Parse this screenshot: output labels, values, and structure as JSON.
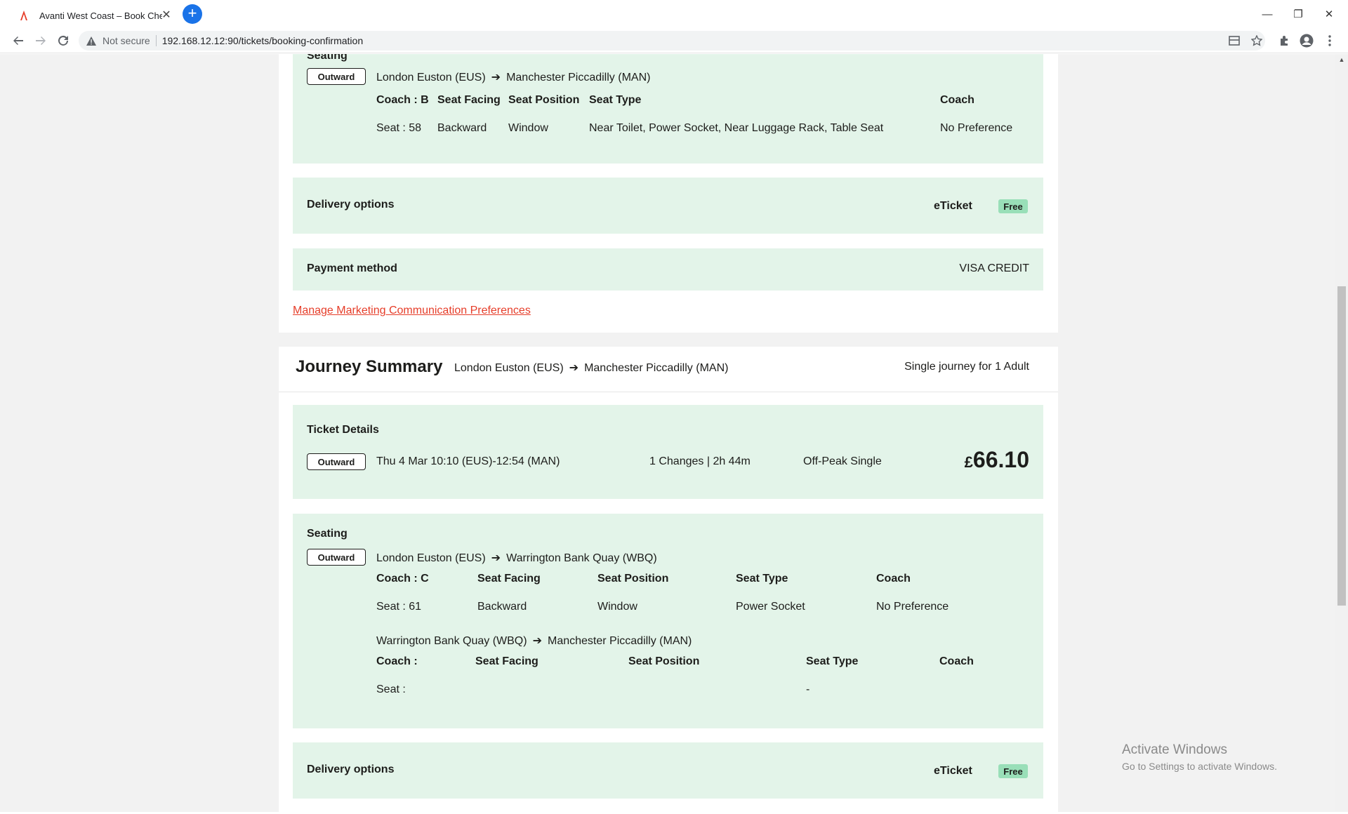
{
  "browser": {
    "tab_title": "Avanti West Coast – Book Cheap",
    "tab_close_glyph": "✕",
    "new_tab_glyph": "+",
    "security_label": "Not secure",
    "url": "192.168.12.12:90/tickets/booking-confirmation",
    "window_controls": {
      "minimize": "—",
      "restore": "❐",
      "close": "✕"
    }
  },
  "top_seating": {
    "direction_badge": "Outward",
    "route_from": "London Euston (EUS)",
    "route_to": "Manchester Piccadilly (MAN)",
    "heading": "Seating",
    "headers": {
      "coach": "Coach : B",
      "seat_facing": "Seat Facing",
      "seat_position": "Seat Position",
      "seat_type": "Seat Type",
      "coach_pref": "Coach"
    },
    "row": {
      "seat": "Seat : 58",
      "seat_facing": "Backward",
      "seat_position": "Window",
      "seat_type": "Near Toilet, Power Socket, Near Luggage Rack, Table Seat",
      "coach_pref": "No Preference"
    }
  },
  "top_delivery": {
    "label": "Delivery options",
    "method": "eTicket",
    "badge": "Free"
  },
  "payment": {
    "label": "Payment method",
    "value": "VISA CREDIT"
  },
  "marketing_link": "Manage Marketing Communication Preferences",
  "journey_summary": {
    "title": "Journey Summary",
    "route_from": "London Euston (EUS)",
    "route_to": "Manchester Piccadilly (MAN)",
    "passengers": "Single journey for 1 Adult"
  },
  "ticket_details": {
    "heading": "Ticket Details",
    "direction_badge": "Outward",
    "datetime": "Thu 4 Mar 10:10 (EUS)-12:54 (MAN)",
    "changes_duration": "1 Changes | 2h 44m",
    "ticket_type": "Off-Peak Single",
    "currency": "£",
    "amount": "66.10"
  },
  "seating": {
    "heading": "Seating",
    "direction_badge": "Outward",
    "leg1": {
      "route_from": "London Euston (EUS)",
      "route_to": "Warrington Bank Quay (WBQ)",
      "headers": {
        "coach": "Coach : C",
        "seat_facing": "Seat Facing",
        "seat_position": "Seat Position",
        "seat_type": "Seat Type",
        "coach_pref": "Coach"
      },
      "row": {
        "seat": "Seat : 61",
        "seat_facing": "Backward",
        "seat_position": "Window",
        "seat_type": "Power Socket",
        "coach_pref": "No Preference"
      }
    },
    "leg2": {
      "route_from": "Warrington Bank Quay (WBQ)",
      "route_to": "Manchester Piccadilly (MAN)",
      "headers": {
        "coach": "Coach :",
        "seat_facing": "Seat Facing",
        "seat_position": "Seat Position",
        "seat_type": "Seat Type",
        "coach_pref": "Coach"
      },
      "row": {
        "seat": "Seat :",
        "seat_type": "-"
      }
    }
  },
  "bottom_delivery": {
    "label": "Delivery options",
    "method": "eTicket",
    "badge": "Free"
  },
  "watermark": {
    "line1": "Activate Windows",
    "line2": "Go to Settings to activate Windows."
  },
  "arrow_glyph": "➔"
}
